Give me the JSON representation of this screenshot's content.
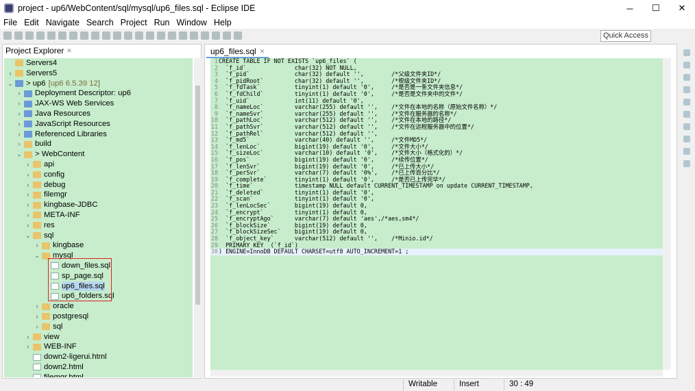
{
  "window": {
    "title": "project - up6/WebContent/sql/mysql/up6_files.sql - Eclipse IDE",
    "minimize": "─",
    "maximize": "☐",
    "close": "✕"
  },
  "menu": [
    "File",
    "Edit",
    "Navigate",
    "Search",
    "Project",
    "Run",
    "Window",
    "Help"
  ],
  "quick_access": "Quick Access",
  "explorer": {
    "title": "Project Explorer",
    "close": "✕",
    "items": [
      {
        "label": "Servers4",
        "depth": 0,
        "arrow": "",
        "icon": "folder"
      },
      {
        "label": "Servers5",
        "depth": 0,
        "arrow": ">",
        "icon": "folder"
      },
      {
        "label": "> up6",
        "deco": "[up6 6.5.39 12]",
        "depth": 0,
        "arrow": "v",
        "icon": "proj"
      },
      {
        "label": "Deployment Descriptor: up6",
        "depth": 1,
        "arrow": ">",
        "icon": "proj"
      },
      {
        "label": "JAX-WS Web Services",
        "depth": 1,
        "arrow": ">",
        "icon": "proj"
      },
      {
        "label": "Java Resources",
        "depth": 1,
        "arrow": ">",
        "icon": "proj"
      },
      {
        "label": "JavaScript Resources",
        "depth": 1,
        "arrow": ">",
        "icon": "proj"
      },
      {
        "label": "Referenced Libraries",
        "depth": 1,
        "arrow": ">",
        "icon": "proj"
      },
      {
        "label": "build",
        "depth": 1,
        "arrow": ">",
        "icon": "folder"
      },
      {
        "label": "> WebContent",
        "depth": 1,
        "arrow": "v",
        "icon": "folder"
      },
      {
        "label": "api",
        "depth": 2,
        "arrow": ">",
        "icon": "folder"
      },
      {
        "label": "config",
        "depth": 2,
        "arrow": ">",
        "icon": "folder"
      },
      {
        "label": "debug",
        "depth": 2,
        "arrow": ">",
        "icon": "folder"
      },
      {
        "label": "filemgr",
        "depth": 2,
        "arrow": ">",
        "icon": "folder"
      },
      {
        "label": "kingbase-JDBC",
        "depth": 2,
        "arrow": ">",
        "icon": "folder"
      },
      {
        "label": "META-INF",
        "depth": 2,
        "arrow": ">",
        "icon": "folder"
      },
      {
        "label": "res",
        "depth": 2,
        "arrow": ">",
        "icon": "folder"
      },
      {
        "label": "sql",
        "depth": 2,
        "arrow": "v",
        "icon": "folder"
      },
      {
        "label": "kingbase",
        "depth": 3,
        "arrow": ">",
        "icon": "folder"
      },
      {
        "label": "mysql",
        "depth": 3,
        "arrow": "v",
        "icon": "folder"
      },
      {
        "label": "down_files.sql",
        "depth": 4,
        "arrow": "",
        "icon": "file"
      },
      {
        "label": "sp_page.sql",
        "depth": 4,
        "arrow": "",
        "icon": "file"
      },
      {
        "label": "up6_files.sql",
        "depth": 4,
        "arrow": "",
        "icon": "file",
        "selected": true
      },
      {
        "label": "up6_folders.sql",
        "depth": 4,
        "arrow": "",
        "icon": "file"
      },
      {
        "label": "oracle",
        "depth": 3,
        "arrow": ">",
        "icon": "folder"
      },
      {
        "label": "postgresql",
        "depth": 3,
        "arrow": ">",
        "icon": "folder"
      },
      {
        "label": "sql",
        "depth": 3,
        "arrow": ">",
        "icon": "folder"
      },
      {
        "label": "view",
        "depth": 2,
        "arrow": ">",
        "icon": "folder"
      },
      {
        "label": "WEB-INF",
        "depth": 2,
        "arrow": ">",
        "icon": "folder"
      },
      {
        "label": "down2-ligerui.html",
        "depth": 2,
        "arrow": "",
        "icon": "file"
      },
      {
        "label": "down2.html",
        "depth": 2,
        "arrow": "",
        "icon": "file"
      },
      {
        "label": "filemgr.html",
        "depth": 2,
        "arrow": "",
        "icon": "file"
      }
    ]
  },
  "editor": {
    "tab": "up6_files.sql",
    "close": "✕",
    "current_line": 30,
    "lines": [
      "CREATE TABLE IF NOT EXISTS `up6_files` (",
      "  `f_id`              char(32) NOT NULL,",
      "  `f_pid`             char(32) default '',        /*父级文件夹ID*/",
      "  `f_pidRoot`         char(32) default '',        /*根级文件夹ID*/",
      "  `f_fdTask`          tinyint(1) default '0',     /*是否是一条文件夹信息*/",
      "  `f_fdChild`         tinyint(1) default '0',     /*是否是文件夹中的文件*/",
      "  `f_uid`             int(11) default '0',",
      "  `f_nameLoc`         varchar(255) default '',    /*文件在本地的名称（原始文件名称）*/",
      "  `f_nameSvr`         varchar(255) default '',    /*文件在服务器的名称*/",
      "  `f_pathLoc`         varchar(512) default '',    /*文件在本地的路径*/",
      "  `f_pathSvr`         varchar(512) default '',    /*文件在远程服务器中的位置*/",
      "  `f_pathRel`         varchar(512) default '',",
      "  `f_md5`             varchar(40) default '',     /*文件MD5*/",
      "  `f_lenLoc`          bigint(19) default '0',     /*文件大小*/",
      "  `f_sizeLoc`         varchar(10) default '0',    /*文件大小（格式化的）*/",
      "  `f_pos`             bigint(19) default '0',     /*续传位置*/",
      "  `f_lenSvr`          bigint(19) default '0',     /*已上传大小*/",
      "  `f_perSvr`          varchar(7) default '0%',    /*已上传百分比*/",
      "  `f_complete`        tinyint(1) default '0',     /*是否已上传完毕*/",
      "  `f_time`            timestamp NULL default CURRENT_TIMESTAMP on update CURRENT_TIMESTAMP,",
      "  `f_deleted`         tinyint(1) default '0',",
      "  `f_scan`            tinyint(1) default '0',",
      "  `f_lenLocSec`       bigint(19) default 0,",
      "  `f_encrypt`         tinyint(1) default 0,",
      "  `f_encryptAgo`      varchar(7) default 'aes',/*aes,sm4*/",
      "  `f_blockSize`       bigint(19) default 0,",
      "  `f_blockSizeSec`    bigint(19) default 0,",
      "  `f_object_key`      varchar(512) default '',    /*Minio.id*/",
      "  PRIMARY KEY  (`f_id`)",
      ") ENGINE=InnoDB DEFAULT CHARSET=utf8 AUTO_INCREMENT=1 ;"
    ]
  },
  "status": {
    "mode": "Writable",
    "insert": "Insert",
    "position": "30 : 49"
  },
  "colors": {
    "editor_bg": "#c7edcc",
    "selection_box": "#e02020"
  }
}
